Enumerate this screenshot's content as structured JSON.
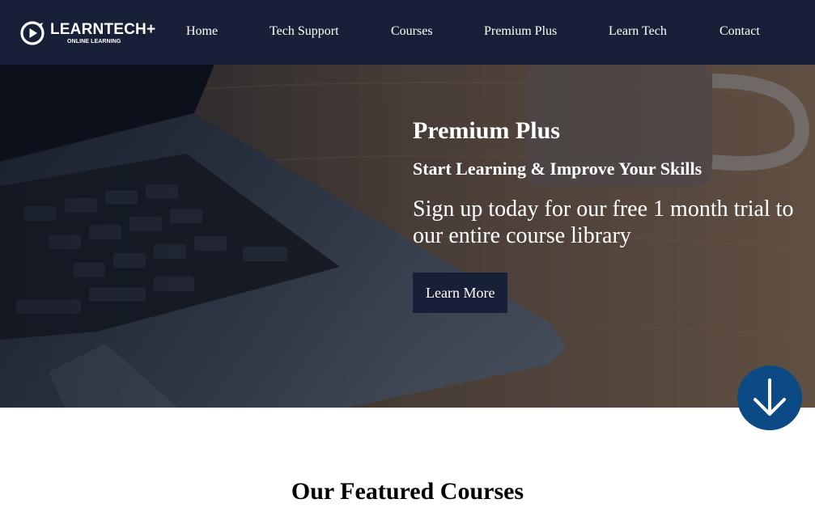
{
  "brand": {
    "name": "LEARNTECH+",
    "tagline": "ONLINE LEARNING",
    "logo_icon": "play-circle-icon"
  },
  "nav": {
    "items": [
      {
        "label": "Home"
      },
      {
        "label": "Tech Support"
      },
      {
        "label": "Courses"
      },
      {
        "label": "Premium Plus"
      },
      {
        "label": "Learn Tech"
      },
      {
        "label": "Contact"
      }
    ]
  },
  "hero": {
    "title": "Premium Plus",
    "subtitle": "Start Learning & Improve Your Skills",
    "text": "Sign up today for our free 1 month trial to our entire course library",
    "button_label": "Learn More",
    "background_image": "laptop-and-coffee-mug-on-wooden-desk"
  },
  "scroll_button": {
    "icon": "arrow-down-icon"
  },
  "featured": {
    "heading": "Our Featured Courses"
  },
  "colors": {
    "navbar": "#182038",
    "button": "#182038",
    "scroll_button": "#0c4a86",
    "text_light": "#ffffff"
  }
}
